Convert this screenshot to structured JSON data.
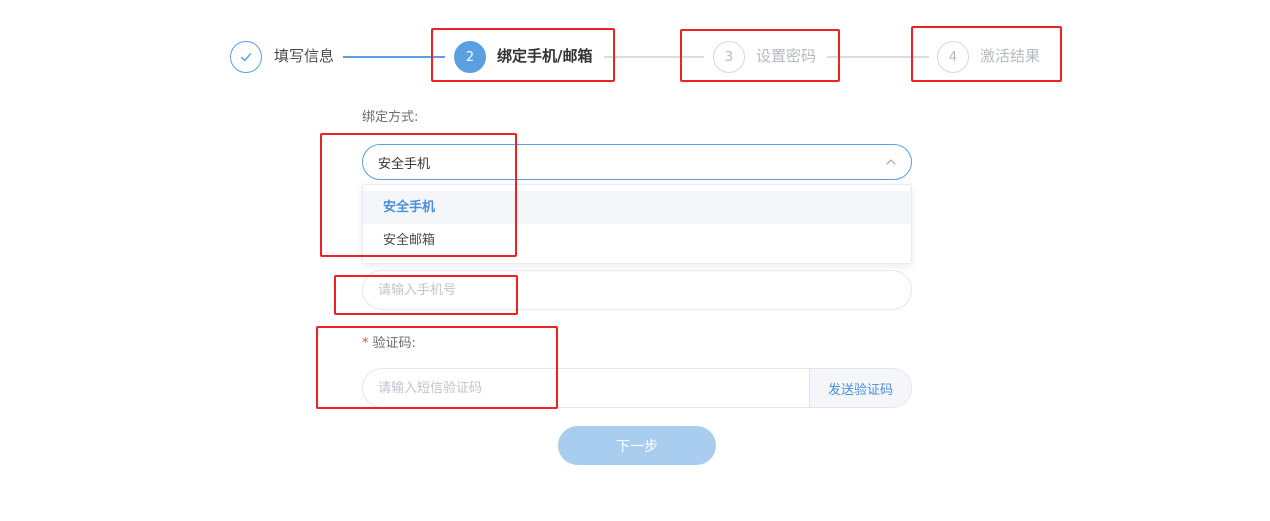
{
  "steps": [
    {
      "label": "填写信息",
      "state": "done",
      "icon": "check-icon"
    },
    {
      "label": "绑定手机/邮箱",
      "state": "active",
      "number": "2"
    },
    {
      "label": "设置密码",
      "state": "pending",
      "number": "3"
    },
    {
      "label": "激活结果",
      "state": "pending",
      "number": "4"
    }
  ],
  "form": {
    "bind_method": {
      "label": "绑定方式:",
      "selected": "安全手机",
      "options": [
        "安全手机",
        "安全邮箱"
      ],
      "open": true
    },
    "phone": {
      "placeholder": "请输入手机号",
      "value": ""
    },
    "code": {
      "required_mark": "*",
      "label": "验证码:",
      "placeholder": "请输入短信验证码",
      "value": "",
      "send_label": "发送验证码"
    },
    "next_label": "下一步"
  },
  "colors": {
    "primary": "#5b9fe0",
    "link": "#4a90d9",
    "disabled_button": "#a9cdee",
    "pending": "#b5b9c0",
    "annotation": "#ee2222",
    "required": "#e94b4b"
  }
}
